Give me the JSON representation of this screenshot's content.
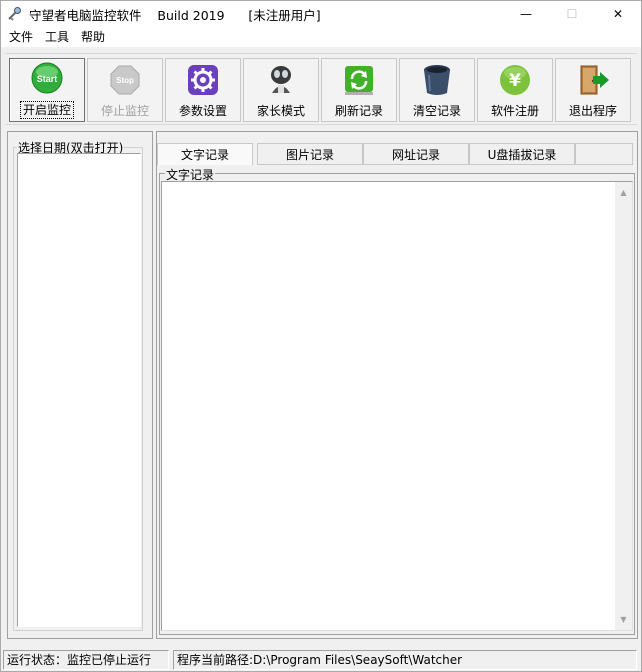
{
  "window": {
    "title": "守望者电脑监控软件    Build 2019      [未注册用户]",
    "minimize_glyph": "—",
    "maximize_glyph": "☐",
    "close_glyph": "✕"
  },
  "menu": [
    "文件",
    "工具",
    "帮助"
  ],
  "toolbar": {
    "buttons": [
      {
        "label": "开启监控",
        "icon": "start-icon",
        "icon_text": "Start",
        "state": "pressed"
      },
      {
        "label": "停止监控",
        "icon": "stop-icon",
        "icon_text": "Stop",
        "state": "disabled"
      },
      {
        "label": "参数设置",
        "icon": "gear-icon"
      },
      {
        "label": "家长模式",
        "icon": "parent-mode-icon"
      },
      {
        "label": "刷新记录",
        "icon": "refresh-icon"
      },
      {
        "label": "清空记录",
        "icon": "trash-icon"
      },
      {
        "label": "软件注册",
        "icon": "yen-icon",
        "icon_text": "¥"
      },
      {
        "label": "退出程序",
        "icon": "exit-door-icon"
      }
    ]
  },
  "left_panel": {
    "legend": "选择日期(双击打开)"
  },
  "tabs": [
    {
      "label": "文字记录",
      "active": true
    },
    {
      "label": "图片记录"
    },
    {
      "label": "网址记录"
    },
    {
      "label": "U盘插拔记录"
    }
  ],
  "text_record": {
    "legend": "文字记录"
  },
  "status": {
    "run_state": "运行状态：监控已停止运行",
    "path": "程序当前路径:D:\\Program Files\\SeaySoft\\Watcher"
  },
  "colors": {
    "start_green": "#2fae3a",
    "gear_purple": "#6a3fc0",
    "refresh_green": "#43b02a",
    "yen_green": "#7cc23c",
    "exit_green": "#1a9a2a"
  }
}
